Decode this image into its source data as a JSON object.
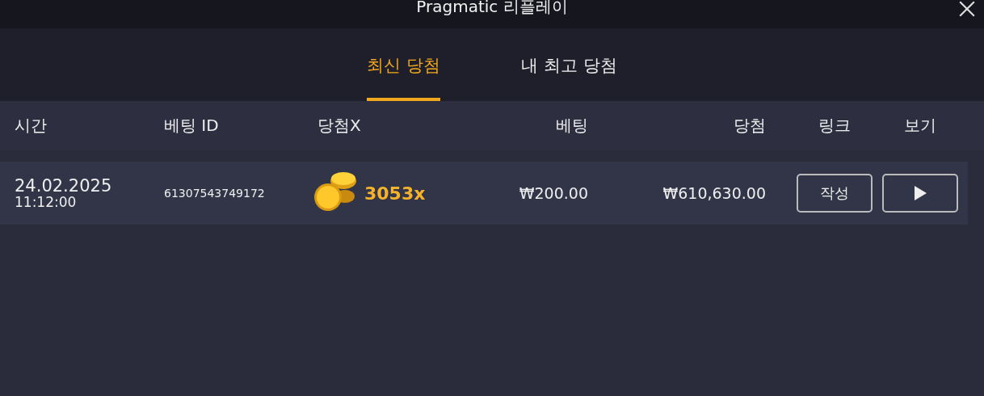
{
  "window": {
    "title": "Pragmatic 리플레이"
  },
  "tabs": [
    {
      "label": "최신 당첨",
      "selected": true
    },
    {
      "label": "내 최고 당첨",
      "selected": false
    }
  ],
  "table": {
    "columns": [
      "시간",
      "베팅 ID",
      "당첨X",
      "베팅",
      "당첨",
      "링크",
      "보기"
    ],
    "rows": [
      {
        "date": "24.02.2025",
        "time": "11:12:00",
        "bet_id": "61307543749172",
        "multiplier": "3053x",
        "bet": "₩200.00",
        "win": "₩610,630.00",
        "link_button": "작성"
      }
    ]
  }
}
